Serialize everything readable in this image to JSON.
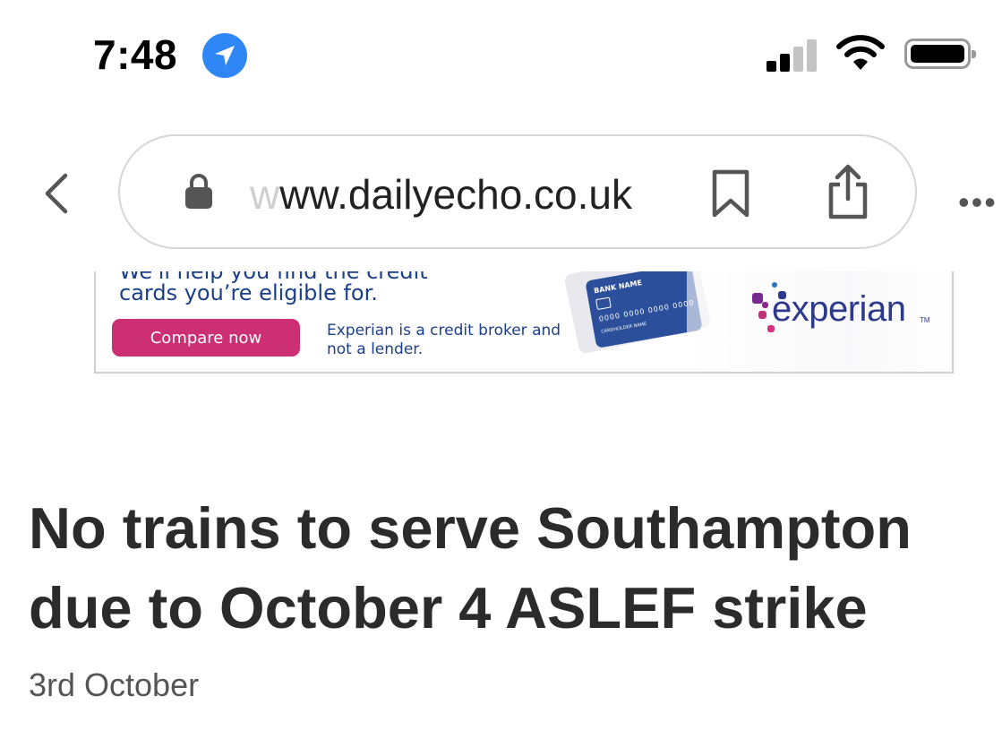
{
  "status_bar": {
    "time": "7:48",
    "location_icon": "location-arrow-icon",
    "signal_icon": "cellular-signal-icon",
    "wifi_icon": "wifi-icon",
    "battery_icon": "battery-icon",
    "signal_bars_active": 2,
    "signal_bars_total": 4
  },
  "browser": {
    "back_icon": "chevron-left-icon",
    "lock_icon": "lock-icon",
    "url_prefix": "w",
    "url": "ww.dailyecho.co.uk",
    "bookmark_icon": "bookmark-icon",
    "share_icon": "share-icon",
    "more_icon": "ellipsis-icon",
    "more_label": "•••"
  },
  "ad": {
    "cut_line": "We'll help you find the credit",
    "line": "cards you’re eligible for.",
    "button_label": "Compare now",
    "note": "Experian is a credit broker and not a lender.",
    "card_bank_name": "BANK NAME",
    "card_number": "0000 0000 0000 0000",
    "card_holder": "CARDHOLDER NAME",
    "brand": "experian",
    "brand_tm": "TM",
    "colors": {
      "button": "#cc2f73",
      "text": "#1b3f8a",
      "brand": "#2d3a8c"
    }
  },
  "article": {
    "headline": "No trains to serve Southampton due to October 4 ASLEF strike",
    "date": "3rd October"
  }
}
